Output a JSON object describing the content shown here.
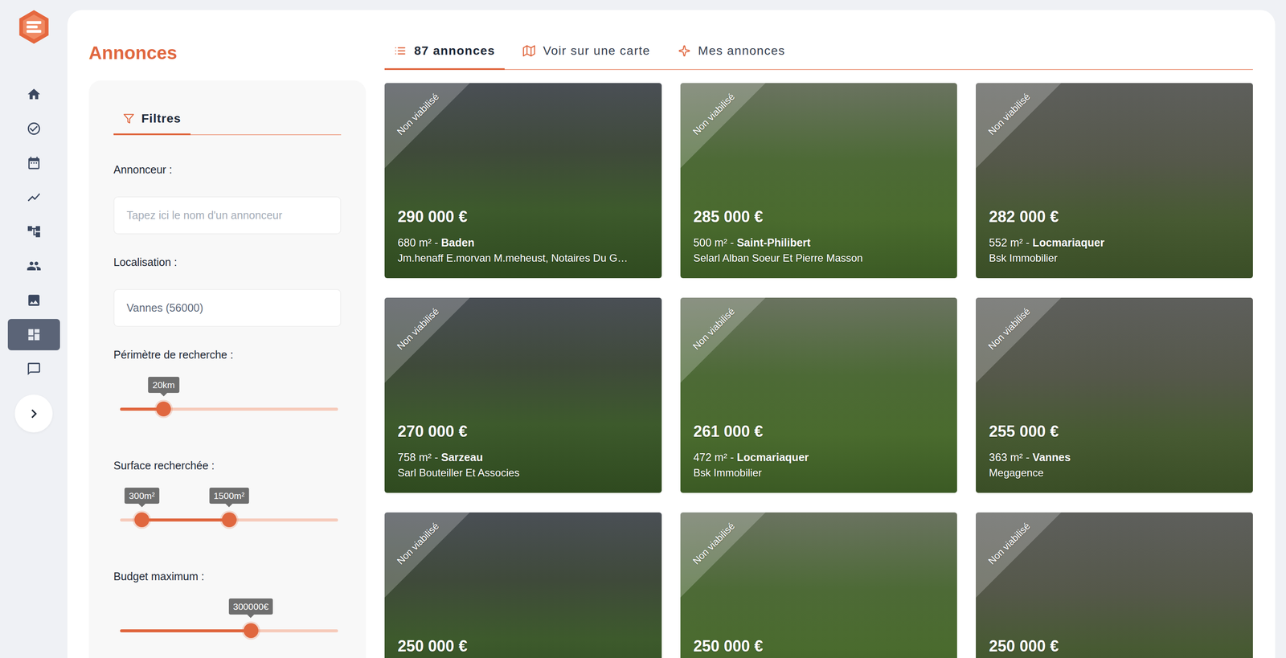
{
  "page": {
    "title": "Annonces"
  },
  "sidebar": {
    "items": [
      {
        "selected": false
      },
      {
        "selected": false
      },
      {
        "selected": false
      },
      {
        "selected": false
      },
      {
        "selected": false
      },
      {
        "selected": false
      },
      {
        "selected": false
      },
      {
        "selected": true
      },
      {
        "selected": false
      }
    ]
  },
  "tabs": [
    {
      "label": "87 annonces",
      "selected": true
    },
    {
      "label": "Voir sur une carte",
      "selected": false
    },
    {
      "label": "Mes annonces",
      "selected": false
    }
  ],
  "filters": {
    "tab": {
      "label": "Filtres",
      "selected": true
    },
    "fields": [
      {
        "kind": "text",
        "label": "Annonceur :",
        "placeholder": "Tapez ici le nom d'un annonceur"
      },
      {
        "kind": "text",
        "label": "Localisation :",
        "value": "Vannes (56000)"
      },
      {
        "kind": "slider",
        "label": "Périmètre de recherche :",
        "level": 0.2,
        "reading": "20km"
      },
      {
        "kind": "range",
        "label": "Surface recherchée :",
        "low": 0.1,
        "high": 0.5,
        "readings": [
          "300m²",
          "1500m²"
        ]
      },
      {
        "kind": "slider",
        "label": "Budget maximum :",
        "level": 0.6,
        "reading": "300000€"
      }
    ]
  },
  "listings": [
    {
      "badge": "Non viabilisé",
      "price": "290 000 €",
      "surface": "680 m² - ",
      "city": "Baden",
      "advertiser": "Jm.henaff E.morvan M.meheust, Notaires Du G…"
    },
    {
      "badge": "Non viabilisé",
      "price": "285 000 €",
      "surface": "500 m² - ",
      "city": "Saint-Philibert",
      "advertiser": "Selarl Alban Soeur Et Pierre Masson"
    },
    {
      "badge": "Non viabilisé",
      "price": "282 000 €",
      "surface": "552 m² - ",
      "city": "Locmariaquer",
      "advertiser": "Bsk Immobilier"
    },
    {
      "badge": "Non viabilisé",
      "price": "270 000 €",
      "surface": "758 m² - ",
      "city": "Sarzeau",
      "advertiser": "Sarl Bouteiller Et Associes"
    },
    {
      "badge": "Non viabilisé",
      "price": "261 000 €",
      "surface": "472 m² - ",
      "city": "Locmariaquer",
      "advertiser": "Bsk Immobilier"
    },
    {
      "badge": "Non viabilisé",
      "price": "255 000 €",
      "surface": "363 m² - ",
      "city": "Vannes",
      "advertiser": "Megagence"
    },
    {
      "badge": "Non viabilisé",
      "price": "250 000 €"
    },
    {
      "badge": "Non viabilisé",
      "price": "250 000 €"
    },
    {
      "badge": "Non viabilisé",
      "price": "250 000 €"
    }
  ]
}
